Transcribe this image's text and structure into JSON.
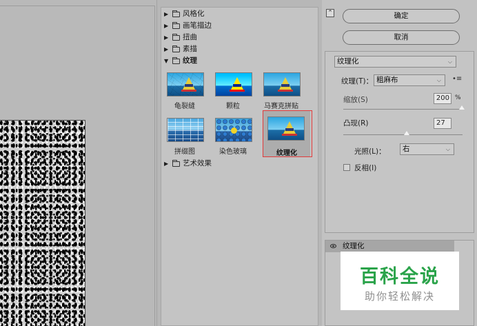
{
  "gallery": {
    "folders_top": [
      {
        "label": "风格化",
        "expanded": false
      },
      {
        "label": "画笔描边",
        "expanded": false
      },
      {
        "label": "扭曲",
        "expanded": false
      },
      {
        "label": "素描",
        "expanded": false
      },
      {
        "label": "纹理",
        "expanded": true
      }
    ],
    "thumbnails": [
      {
        "label": "龟裂缝"
      },
      {
        "label": "颗粒"
      },
      {
        "label": "马赛克拼贴"
      },
      {
        "label": "拼缀图"
      },
      {
        "label": "染色玻璃"
      },
      {
        "label": "纹理化",
        "selected": true
      }
    ],
    "folders_bottom": [
      {
        "label": "艺术效果",
        "expanded": false
      }
    ],
    "highlight_color": "#e23a3a"
  },
  "buttons": {
    "collapse_icon": "⌃",
    "ok_label": "确定",
    "cancel_label": "取消"
  },
  "settings": {
    "filter_select": "纹理化",
    "texture_label": "纹理(T)：",
    "texture_value": "粗麻布",
    "texture_menu": "•≡",
    "scale_label": "缩放(S)",
    "scale_value": "200",
    "scale_unit": "%",
    "relief_label": "凸现(R)",
    "relief_value": "27",
    "light_label": "光照(L)：",
    "light_value": "右",
    "invert_label": "反相(I)",
    "invert_checked": false
  },
  "layers": {
    "item_label": "纹理化"
  },
  "watermark": {
    "title": "百科全说",
    "subtitle": "助你轻松解决"
  },
  "colors": {
    "watermark_green": "#2aa34a",
    "panel_bg": "#c2c2c2"
  }
}
